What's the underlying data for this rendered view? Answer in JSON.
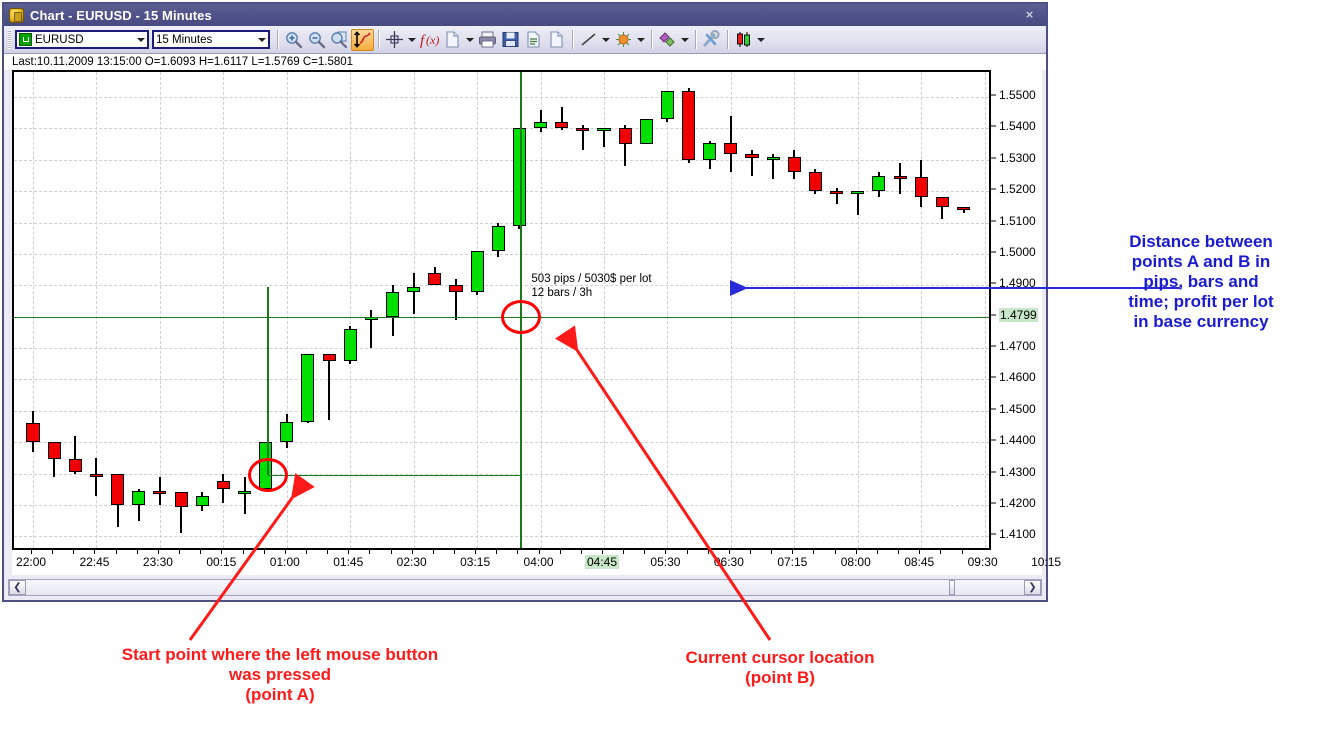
{
  "window": {
    "title": "Chart - EURUSD - 15 Minutes",
    "close_label": "×",
    "icon": "chart-app-icon"
  },
  "toolbar": {
    "symbol": "EURUSD",
    "period": "15 Minutes",
    "buttons": [
      {
        "name": "zoom-in-icon",
        "label": "Zoom In"
      },
      {
        "name": "zoom-out-icon",
        "label": "Zoom Out"
      },
      {
        "name": "zoom-all-icon",
        "label": "Zoom All"
      },
      {
        "name": "autoscale-icon",
        "label": "Auto Scale"
      },
      {
        "name": "crosshair-icon",
        "label": "Crosshair"
      },
      {
        "name": "indicators-icon",
        "label": "Indicators"
      },
      {
        "name": "new-doc-icon",
        "label": "New"
      },
      {
        "name": "print-icon",
        "label": "Print"
      },
      {
        "name": "save-icon",
        "label": "Save"
      },
      {
        "name": "report-icon",
        "label": "Report"
      },
      {
        "name": "page-icon",
        "label": "Page"
      },
      {
        "name": "line-tool-icon",
        "label": "Line"
      },
      {
        "name": "fibonacci-icon",
        "label": "Fibonacci"
      },
      {
        "name": "objects-icon",
        "label": "Objects"
      },
      {
        "name": "tools-icon",
        "label": "Tools"
      },
      {
        "name": "candles-icon",
        "label": "Bar Style"
      }
    ]
  },
  "quote_line": "Last:10.11.2009 13:15:00 O=1.6093 H=1.6117 L=1.5769 C=1.5801",
  "measure_tooltip": {
    "line1": "503 pips / 5030$ per lot",
    "line2": "12 bars / 3h"
  },
  "annotations": {
    "right": "Distance between\npoints A and B in\npips, bars and\ntime; profit per lot\nin base currency",
    "bottom_left": "Start point where the left mouse button\nwas pressed\n(point A)",
    "bottom_right": "Current cursor location\n(point B)"
  },
  "scrollbar": {
    "left_arrow": "❮",
    "right_arrow": "❯"
  },
  "colors": {
    "up_candle": "#00e000",
    "down_candle": "#f00000",
    "crosshair": "#1a7a1a",
    "marker": "#ff0000",
    "annotation_blue": "#1a1ad0",
    "annotation_red": "#ff1a1a",
    "highlight": "#c8e6c8"
  },
  "chart_data": {
    "type": "candlestick",
    "title": "EURUSD - 15 Minutes",
    "symbol": "EURUSD",
    "timeframe": "15 Minutes",
    "xlabel": "",
    "ylabel": "",
    "ylim": [
      1.405,
      1.558
    ],
    "grid": true,
    "y_ticks": [
      1.55,
      1.54,
      1.53,
      1.52,
      1.51,
      1.5,
      1.49,
      1.4799,
      1.47,
      1.46,
      1.45,
      1.44,
      1.43,
      1.42,
      1.41
    ],
    "y_tick_labels": [
      "1.5500",
      "1.5400",
      "1.5300",
      "1.5200",
      "1.5100",
      "1.5000",
      "1.4900",
      "1.4799",
      "1.4700",
      "1.4600",
      "1.4500",
      "1.4400",
      "1.4300",
      "1.4200",
      "1.4100"
    ],
    "current_price": 1.4799,
    "x_ticks": [
      "22:00",
      "22:45",
      "23:30",
      "00:15",
      "01:00",
      "01:45",
      "02:30",
      "03:15",
      "04:00",
      "04:45",
      "05:30",
      "06:30",
      "07:15",
      "08:00",
      "08:45",
      "09:30",
      "10:15"
    ],
    "current_time": "04:45",
    "point_a": {
      "time": "01:15",
      "price": 1.4296,
      "label": "point A"
    },
    "point_b": {
      "time": "04:45",
      "price": 1.4799,
      "label": "point B"
    },
    "measurement": {
      "pips": 503,
      "profit_per_lot": "5030$",
      "bars": 12,
      "duration": "3h"
    },
    "candles": [
      {
        "o": 1.446,
        "h": 1.45,
        "l": 1.437,
        "c": 1.44
      },
      {
        "o": 1.44,
        "h": 1.44,
        "l": 1.429,
        "c": 1.4345
      },
      {
        "o": 1.4345,
        "h": 1.442,
        "l": 1.43,
        "c": 1.4305
      },
      {
        "o": 1.43,
        "h": 1.435,
        "l": 1.423,
        "c": 1.4298
      },
      {
        "o": 1.4298,
        "h": 1.4298,
        "l": 1.413,
        "c": 1.42
      },
      {
        "o": 1.42,
        "h": 1.425,
        "l": 1.415,
        "c": 1.4245
      },
      {
        "o": 1.4245,
        "h": 1.429,
        "l": 1.42,
        "c": 1.424
      },
      {
        "o": 1.424,
        "h": 1.424,
        "l": 1.411,
        "c": 1.4195
      },
      {
        "o": 1.4195,
        "h": 1.424,
        "l": 1.418,
        "c": 1.423
      },
      {
        "o": 1.4275,
        "h": 1.43,
        "l": 1.4205,
        "c": 1.425
      },
      {
        "o": 1.424,
        "h": 1.429,
        "l": 1.417,
        "c": 1.4245
      },
      {
        "o": 1.425,
        "h": 1.44,
        "l": 1.4245,
        "c": 1.44
      },
      {
        "o": 1.44,
        "h": 1.449,
        "l": 1.438,
        "c": 1.4465
      },
      {
        "o": 1.4465,
        "h": 1.468,
        "l": 1.446,
        "c": 1.468
      },
      {
        "o": 1.468,
        "h": 1.468,
        "l": 1.447,
        "c": 1.466
      },
      {
        "o": 1.466,
        "h": 1.477,
        "l": 1.465,
        "c": 1.476
      },
      {
        "o": 1.479,
        "h": 1.482,
        "l": 1.47,
        "c": 1.48
      },
      {
        "o": 1.48,
        "h": 1.49,
        "l": 1.474,
        "c": 1.488
      },
      {
        "o": 1.488,
        "h": 1.494,
        "l": 1.481,
        "c": 1.4895
      },
      {
        "o": 1.494,
        "h": 1.496,
        "l": 1.49,
        "c": 1.49
      },
      {
        "o": 1.49,
        "h": 1.492,
        "l": 1.479,
        "c": 1.488
      },
      {
        "o": 1.488,
        "h": 1.501,
        "l": 1.487,
        "c": 1.501
      },
      {
        "o": 1.501,
        "h": 1.51,
        "l": 1.499,
        "c": 1.509
      },
      {
        "o": 1.509,
        "h": 1.54,
        "l": 1.508,
        "c": 1.54
      },
      {
        "o": 1.54,
        "h": 1.546,
        "l": 1.539,
        "c": 1.542
      },
      {
        "o": 1.542,
        "h": 1.547,
        "l": 1.5395,
        "c": 1.54
      },
      {
        "o": 1.54,
        "h": 1.541,
        "l": 1.533,
        "c": 1.5395
      },
      {
        "o": 1.5395,
        "h": 1.54,
        "l": 1.534,
        "c": 1.54
      },
      {
        "o": 1.54,
        "h": 1.541,
        "l": 1.528,
        "c": 1.535
      },
      {
        "o": 1.535,
        "h": 1.543,
        "l": 1.535,
        "c": 1.543
      },
      {
        "o": 1.543,
        "h": 1.552,
        "l": 1.542,
        "c": 1.552
      },
      {
        "o": 1.552,
        "h": 1.553,
        "l": 1.529,
        "c": 1.53
      },
      {
        "o": 1.53,
        "h": 1.536,
        "l": 1.527,
        "c": 1.5355
      },
      {
        "o": 1.5355,
        "h": 1.544,
        "l": 1.526,
        "c": 1.532
      },
      {
        "o": 1.532,
        "h": 1.533,
        "l": 1.525,
        "c": 1.5305
      },
      {
        "o": 1.5305,
        "h": 1.532,
        "l": 1.524,
        "c": 1.531
      },
      {
        "o": 1.531,
        "h": 1.533,
        "l": 1.524,
        "c": 1.526
      },
      {
        "o": 1.526,
        "h": 1.527,
        "l": 1.519,
        "c": 1.52
      },
      {
        "o": 1.52,
        "h": 1.521,
        "l": 1.516,
        "c": 1.5195
      },
      {
        "o": 1.5195,
        "h": 1.52,
        "l": 1.5125,
        "c": 1.52
      },
      {
        "o": 1.52,
        "h": 1.526,
        "l": 1.518,
        "c": 1.525
      },
      {
        "o": 1.525,
        "h": 1.529,
        "l": 1.519,
        "c": 1.5245
      },
      {
        "o": 1.5245,
        "h": 1.53,
        "l": 1.515,
        "c": 1.518
      },
      {
        "o": 1.518,
        "h": 1.518,
        "l": 1.511,
        "c": 1.515
      },
      {
        "o": 1.515,
        "h": 1.515,
        "l": 1.513,
        "c": 1.5145
      }
    ]
  }
}
